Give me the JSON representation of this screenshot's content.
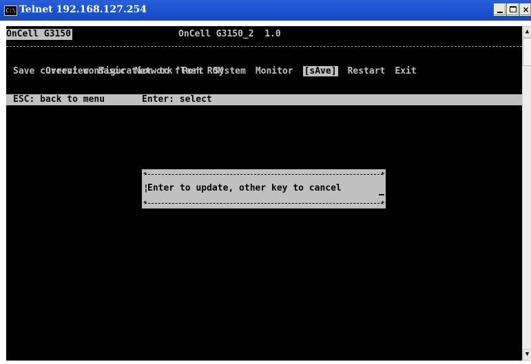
{
  "window": {
    "title": "Telnet 192.168.127.254",
    "icon_label": "C:\\",
    "icon_name": "console-icon",
    "minimize_name": "minimize-icon",
    "maximize_name": "maximize-icon",
    "close_label": "×",
    "accent_color": "#1f55d2"
  },
  "console": {
    "device_name": "OnCell G3150",
    "device_info": "OnCell G3150_2  1.0",
    "menu": [
      {
        "label": "Overview"
      },
      {
        "label": "Basic"
      },
      {
        "label": "Network"
      },
      {
        "label": "Port"
      },
      {
        "label": "System"
      },
      {
        "label": "Monitor"
      },
      {
        "label": "[sAve]",
        "selected": true
      },
      {
        "label": "Restart"
      },
      {
        "label": "Exit"
      }
    ],
    "description": "Save current configuration to flash ROM",
    "status": {
      "esc_hint": "ESC: back to menu",
      "enter_hint": "Enter: select"
    },
    "dialog": {
      "message": "Enter to update, other key to cancel"
    }
  },
  "scrollbar": {
    "up_arrow": "▲",
    "down_arrow": "▼"
  }
}
